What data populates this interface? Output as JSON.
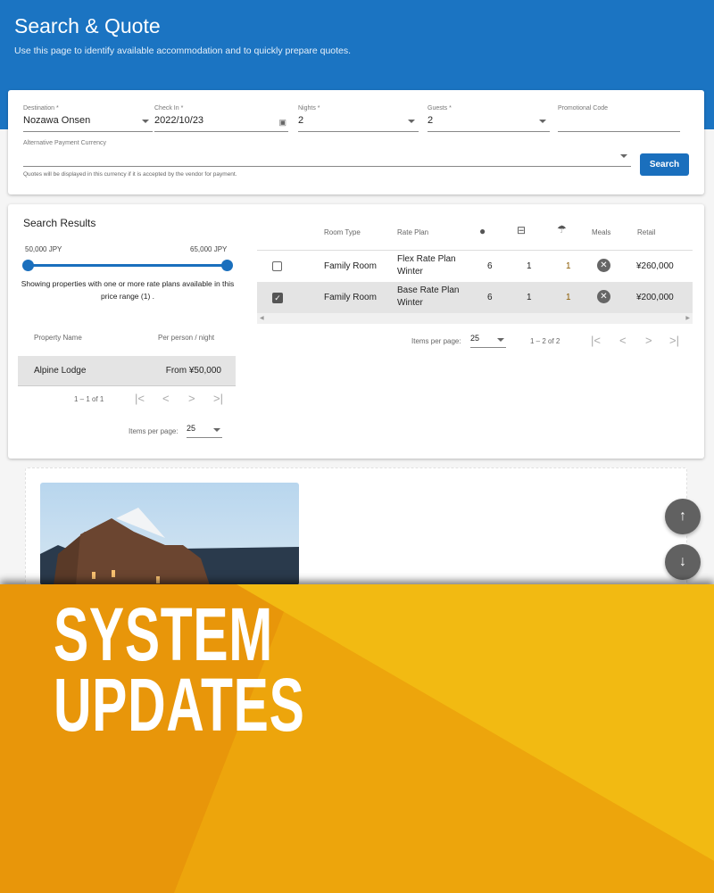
{
  "header": {
    "title": "Search & Quote",
    "subtitle": "Use this page to identify available accommodation and to quickly prepare quotes."
  },
  "form": {
    "destination": {
      "label": "Destination *",
      "value": "Nozawa Onsen"
    },
    "checkin": {
      "label": "Check In *",
      "value": "2022/10/23"
    },
    "nights": {
      "label": "Nights *",
      "value": "2"
    },
    "guests": {
      "label": "Guests *",
      "value": "2"
    },
    "promo": {
      "label": "Promotional Code",
      "value": ""
    },
    "currency": {
      "label": "Alternative Payment Currency",
      "value": "",
      "hint": "Quotes will be displayed in this currency if it is accepted by the vendor for payment."
    },
    "search_label": "Search"
  },
  "results": {
    "title": "Search Results",
    "price_min": "50,000 JPY",
    "price_max": "65,000 JPY",
    "range_note": "Showing properties with one or more rate plans available in this price range (1) .",
    "columns": [
      "Property Name",
      "Per person / night"
    ],
    "rows": [
      {
        "name": "Alpine Lodge",
        "price": "From ¥50,000"
      }
    ],
    "range_label": "1 – 1 of 1",
    "items_per_page_label": "Items per page:",
    "items_per_page": "25"
  },
  "rooms": {
    "columns": [
      "Room Type",
      "Rate Plan",
      "Meals",
      "Retail"
    ],
    "icons": [
      "person-icon",
      "bed-icon",
      "shower-icon"
    ],
    "rows": [
      {
        "checked": false,
        "room": "Family Room",
        "plan1": "Flex Rate Plan",
        "plan2": "Winter",
        "guests": "6",
        "beds": "1",
        "baths": "1",
        "meals": "none",
        "retail": "¥260,000"
      },
      {
        "checked": true,
        "room": "Family Room",
        "plan1": "Base Rate Plan",
        "plan2": "Winter",
        "guests": "6",
        "beds": "1",
        "baths": "1",
        "meals": "none",
        "retail": "¥200,000"
      }
    ],
    "items_per_page_label": "Items per page:",
    "items_per_page": "25",
    "range_label": "1 – 2 of 2"
  },
  "banner": {
    "line1": "SYSTEM",
    "line2": "UPDATES",
    "colors": [
      "#e8960a",
      "#eda50c",
      "#f2ba12"
    ]
  },
  "colors": {
    "primary": "#1b74c2"
  }
}
